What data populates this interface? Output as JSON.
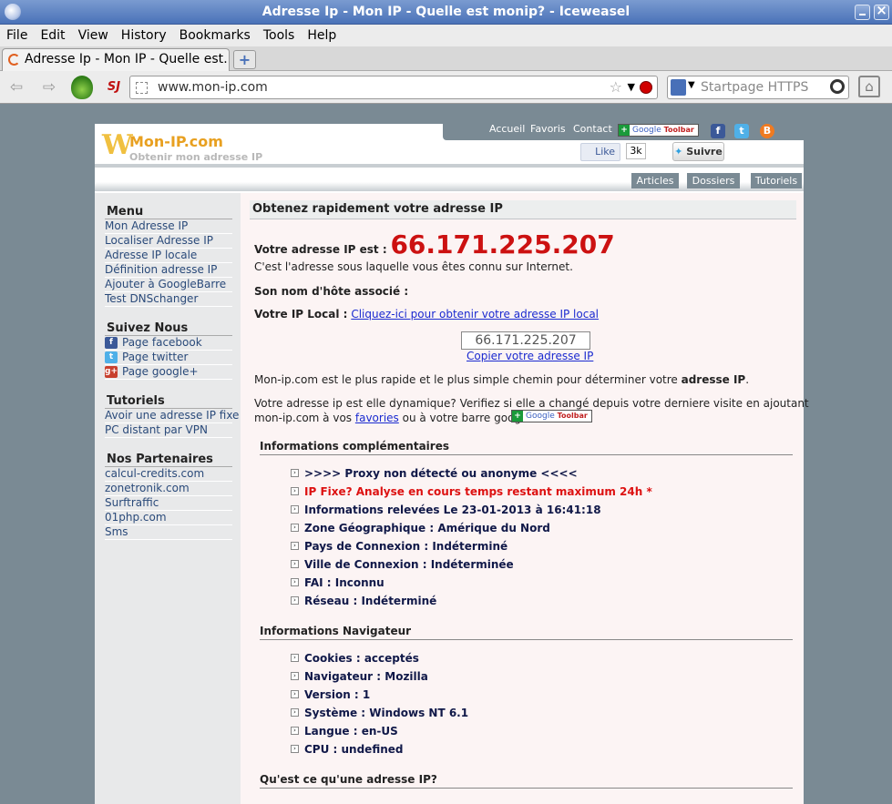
{
  "window": {
    "title": "Adresse Ip - Mon IP - Quelle est monip? - Iceweasel"
  },
  "menu": [
    "File",
    "Edit",
    "View",
    "History",
    "Bookmarks",
    "Tools",
    "Help"
  ],
  "tab": {
    "label": "Adresse Ip - Mon IP - Quelle est…",
    "new_tab_symbol": "+"
  },
  "nav": {
    "url": "www.mon-ip.com",
    "search_placeholder": "Startpage HTTPS",
    "sj_label": "SJ"
  },
  "site": {
    "logo_name": "Mon-IP.com",
    "logo_w": "W",
    "logo_tagline": "Obtenir mon adresse IP",
    "top_links": [
      "Accueil",
      "Favoris",
      "Contact"
    ],
    "google_toolbar": {
      "g": "Google",
      "tb": "Toolbar"
    },
    "like_label": "Like",
    "like_count": "3k",
    "follow_label": "Suivre",
    "section_nav": [
      "Articles",
      "Dossiers",
      "Tutoriels"
    ]
  },
  "sidebar": {
    "menu": {
      "title": "Menu",
      "items": [
        "Mon Adresse IP",
        "Localiser Adresse IP",
        "Adresse IP locale",
        "Définition adresse IP",
        "Ajouter à GoogleBarre",
        "Test DNSchanger"
      ]
    },
    "follow": {
      "title": "Suivez Nous",
      "items": [
        "Page facebook",
        "Page twitter",
        "Page google+"
      ]
    },
    "tutorials": {
      "title": "Tutoriels",
      "items": [
        "Avoir une adresse IP fixe",
        "PC distant par VPN"
      ]
    },
    "partners": {
      "title": "Nos Partenaires",
      "items": [
        "calcul-credits.com",
        "zonetronik.com",
        "Surftraffic",
        "01php.com",
        "Sms"
      ]
    }
  },
  "main": {
    "title": "Obtenez rapidement votre adresse IP",
    "ip_label": "Votre adresse IP est :",
    "ip_value": "66.171.225.207",
    "ip_desc": "C'est l'adresse sous laquelle vous êtes connu sur Internet.",
    "hostname_label": "Son nom d'hôte associé :",
    "local_label": "Votre IP Local :",
    "local_link": "Cliquez-ici pour obtenir votre adresse IP local",
    "ip_box_value": "66.171.225.207",
    "copy_link": "Copier votre adresse IP",
    "fastest_text_a": "Mon-ip.com est le plus rapide et le plus simple chemin pour déterminer votre ",
    "fastest_text_b": "adresse IP",
    "fastest_text_c": ".",
    "dynamic_text_1": "Votre adresse ip est elle dynamique? Verifiez si elle a changé depuis votre derniere visite en ajoutant",
    "dynamic_text_2a": "mon-ip.com à vos ",
    "dynamic_link": "favories",
    "dynamic_text_2b": " ou à votre barre google",
    "info_title": "Informations complémentaires",
    "info_items": [
      "&gt;&gt;&gt;&gt; Proxy non détecté ou anonyme &lt;&lt;&lt;&lt;",
      "IP Fixe? Analyse en cours temps restant maximum 24h *",
      "Informations relevées Le 23-01-2013 à 16:41:18",
      "Zone Géographique : Amérique du Nord",
      "Pays de Connexion : Indéterminé",
      "Ville de Connexion : Indéterminée",
      "FAI : Inconnu",
      "Réseau : Indéterminé"
    ],
    "browser_title": "Informations Navigateur",
    "browser_items": [
      "Cookies : acceptés",
      "Navigateur : Mozilla",
      "Version : 1",
      "Système : Windows NT 6.1",
      "Langue : en-US",
      "CPU : undefined"
    ],
    "what_title": "Qu'est ce qu'une adresse IP?"
  }
}
